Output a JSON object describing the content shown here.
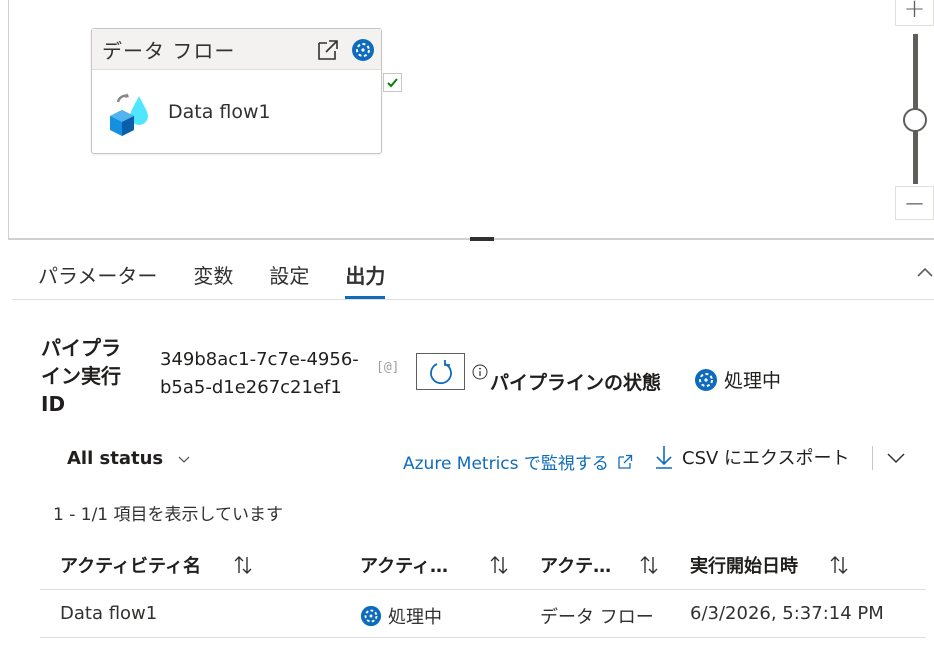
{
  "canvas": {
    "activity": {
      "type_label": "データ フロー",
      "name": "Data flow1"
    },
    "icons": [
      "open-external-icon",
      "in-progress-icon",
      "data-flow-icon",
      "success-check-icon"
    ],
    "zoom": {
      "in_label": "+",
      "out_label": "—"
    }
  },
  "tabs": [
    {
      "label": "パラメーター",
      "active": false
    },
    {
      "label": "変数",
      "active": false
    },
    {
      "label": "設定",
      "active": false
    },
    {
      "label": "出力",
      "active": true
    }
  ],
  "run": {
    "label": "パイプライン実行 ID",
    "id": "349b8ac1-7c7e-4956-b5a5-d1e267c21ef1",
    "copy_label": "[@]",
    "status_label": "パイプラインの状態",
    "status_value": "処理中"
  },
  "toolbar": {
    "status_filter": "All status",
    "azure_metrics": "Azure Metrics で監視する",
    "export_csv": "CSV にエクスポート"
  },
  "item_count": "1 - 1/1 項目を表示しています",
  "table": {
    "columns": [
      "アクティビティ名",
      "アクティ…",
      "アクテ…",
      "実行開始日時"
    ],
    "rows": [
      {
        "name": "Data flow1",
        "status": "処理中",
        "type": "データ フロー",
        "start": "6/3/2026, 5:37:14 PM"
      }
    ]
  },
  "colors": {
    "accent": "#0f6cbd",
    "text": "#201f1e",
    "border": "#e1dfdd"
  }
}
